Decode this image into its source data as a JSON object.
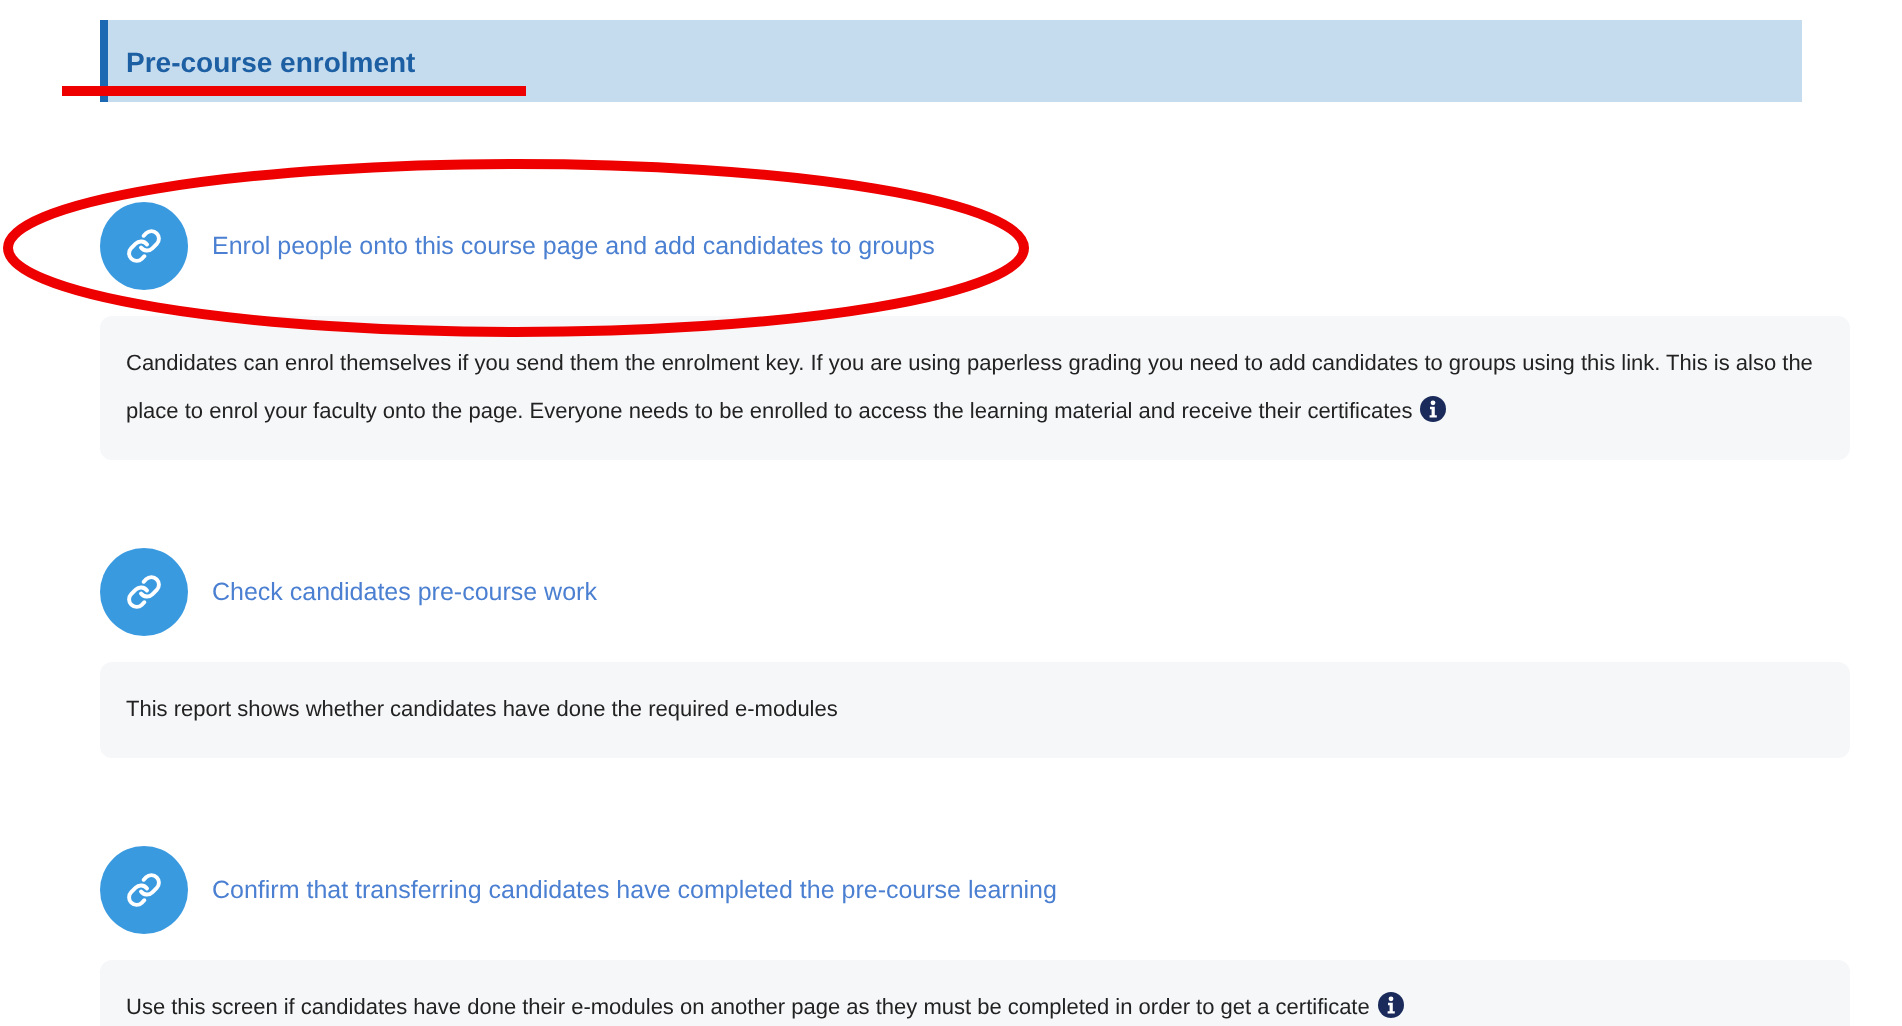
{
  "section": {
    "title": "Pre-course enrolment"
  },
  "activities": [
    {
      "link": "Enrol people onto this course page and add candidates to groups",
      "description": "Candidates can enrol themselves if you send them the enrolment key. If you are using paperless grading you need to add candidates to groups using this link. This is also the place to enrol your faculty onto the page. Everyone needs to be enrolled to access the learning material and receive their certificates",
      "info": true
    },
    {
      "link": "Check candidates pre-course work",
      "description": "This report shows whether candidates have done the required e-modules",
      "info": false
    },
    {
      "link": "Confirm that transferring candidates have completed the pre-course learning",
      "description": "Use this screen if candidates have done their e-modules on another page as they must be completed in order to get a certificate",
      "info": true
    }
  ]
}
